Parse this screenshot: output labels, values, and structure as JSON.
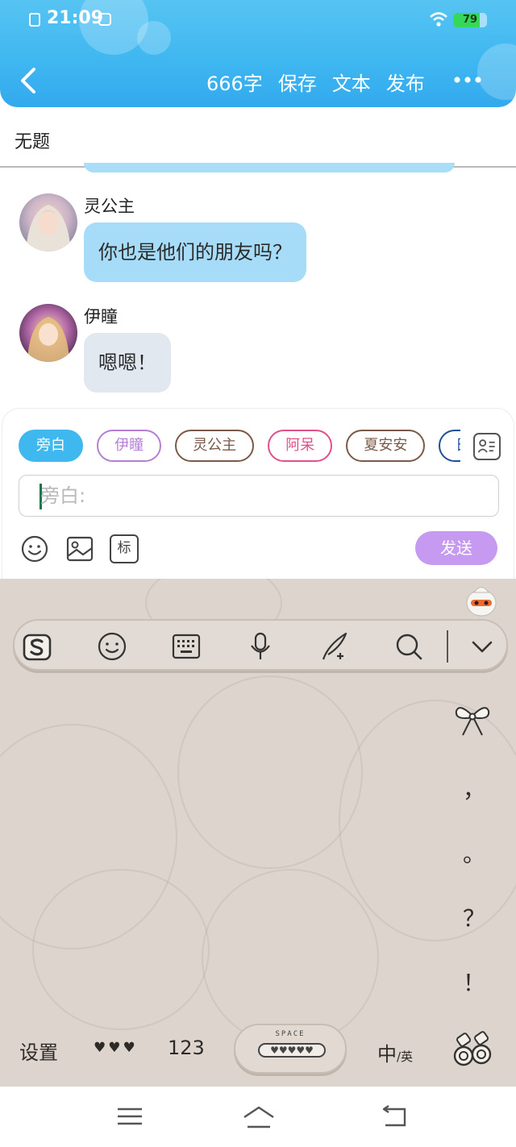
{
  "status_bar": {
    "time": "21:09",
    "battery": "79"
  },
  "header": {
    "word_count": "666字",
    "save_label": "保存",
    "text_label": "文本",
    "publish_label": "发布",
    "title": "无题"
  },
  "messages": [
    {
      "name": "灵公主",
      "text": "你也是他们的朋友吗？",
      "bubble_color": "#a6dcf7"
    },
    {
      "name": "伊瞳",
      "text": "嗯嗯！",
      "bubble_color": "#e2e8f0"
    }
  ],
  "composer": {
    "chips": [
      {
        "label": "旁白",
        "selected": true,
        "color": "#3fb7ef"
      },
      {
        "label": "伊瞳",
        "selected": false,
        "color": "#b57fd6"
      },
      {
        "label": "灵公主",
        "selected": false,
        "color": "#7a5a48"
      },
      {
        "label": "阿呆",
        "selected": false,
        "color": "#e0508a"
      },
      {
        "label": "夏安安",
        "selected": false,
        "color": "#7a5a48"
      },
      {
        "label": "田安淇",
        "selected": false,
        "color": "#1f4f9a"
      }
    ],
    "input_placeholder": "旁白:",
    "tag_label": "标",
    "send_label": "发送"
  },
  "keyboard": {
    "punctuation": [
      "，",
      "。",
      "？",
      "！"
    ],
    "settings_label": "设置",
    "hearts_label": "♥♥♥",
    "numbers_label": "123",
    "space_top_label": "SPACE",
    "space_hearts": "♥♥♥♥♥",
    "lang_primary": "中",
    "lang_secondary": "/英"
  },
  "colors": {
    "header_blue": "#3eb6f0",
    "send_purple": "#c59af0",
    "keyboard_bg": "#dcd4cd"
  }
}
